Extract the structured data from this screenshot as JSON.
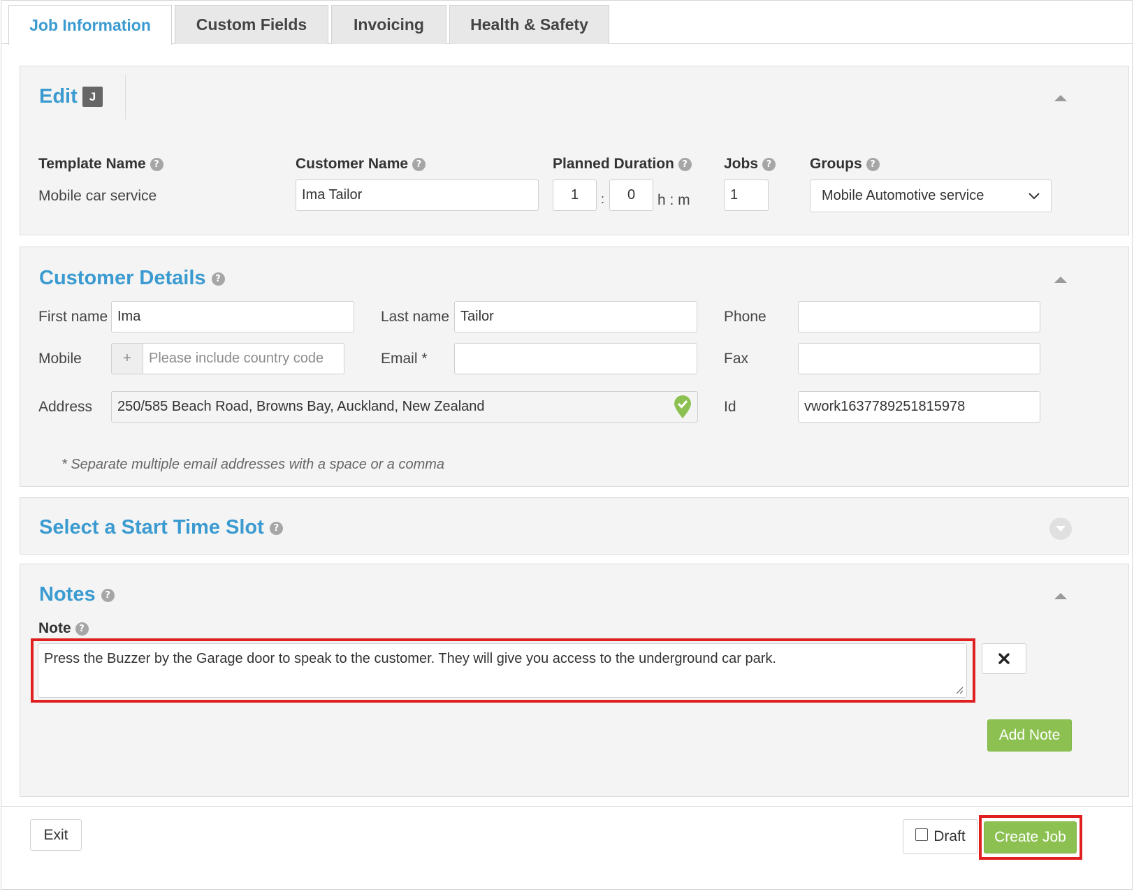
{
  "tabs": [
    {
      "label": "Job Information",
      "active": true
    },
    {
      "label": "Custom Fields",
      "active": false
    },
    {
      "label": "Invoicing",
      "active": false
    },
    {
      "label": "Health & Safety",
      "active": false
    }
  ],
  "edit": {
    "title": "Edit",
    "badge": "J",
    "template_name_label": "Template Name",
    "template_name_value": "Mobile car service",
    "customer_name_label": "Customer Name",
    "customer_name_value": "Ima Tailor",
    "planned_duration_label": "Planned Duration",
    "duration_hours": "1",
    "duration_separator": ":",
    "duration_minutes": "0",
    "duration_unit": "h : m",
    "jobs_label": "Jobs",
    "jobs_value": "1",
    "groups_label": "Groups",
    "groups_value": "Mobile Automotive service"
  },
  "customer_details": {
    "title": "Customer Details",
    "first_name_label": "First name",
    "first_name_value": "Ima",
    "last_name_label": "Last name",
    "last_name_value": "Tailor",
    "phone_label": "Phone",
    "phone_value": "",
    "mobile_label": "Mobile",
    "mobile_prefix": "+",
    "mobile_placeholder": "Please include country code",
    "email_label": "Email *",
    "email_value": "",
    "fax_label": "Fax",
    "fax_value": "",
    "address_label": "Address",
    "address_value": "250/585 Beach Road, Browns Bay, Auckland, New Zealand",
    "id_label": "Id",
    "id_value": "vwork1637789251815978",
    "footnote": "* Separate multiple email addresses with a space or a comma"
  },
  "time_slot": {
    "title": "Select a Start Time Slot"
  },
  "notes": {
    "title": "Notes",
    "note_label": "Note",
    "note_text": "Press the Buzzer by the Garage door to speak to the customer. They will give you access to the underground car park.",
    "remove_icon": "close-icon",
    "add_note_label": "Add Note"
  },
  "footer": {
    "exit_label": "Exit",
    "draft_label": "Draft",
    "create_job_label": "Create Job"
  },
  "colors": {
    "accent": "#3b9bd1",
    "green": "#8cc152",
    "highlight": "#e02020"
  }
}
